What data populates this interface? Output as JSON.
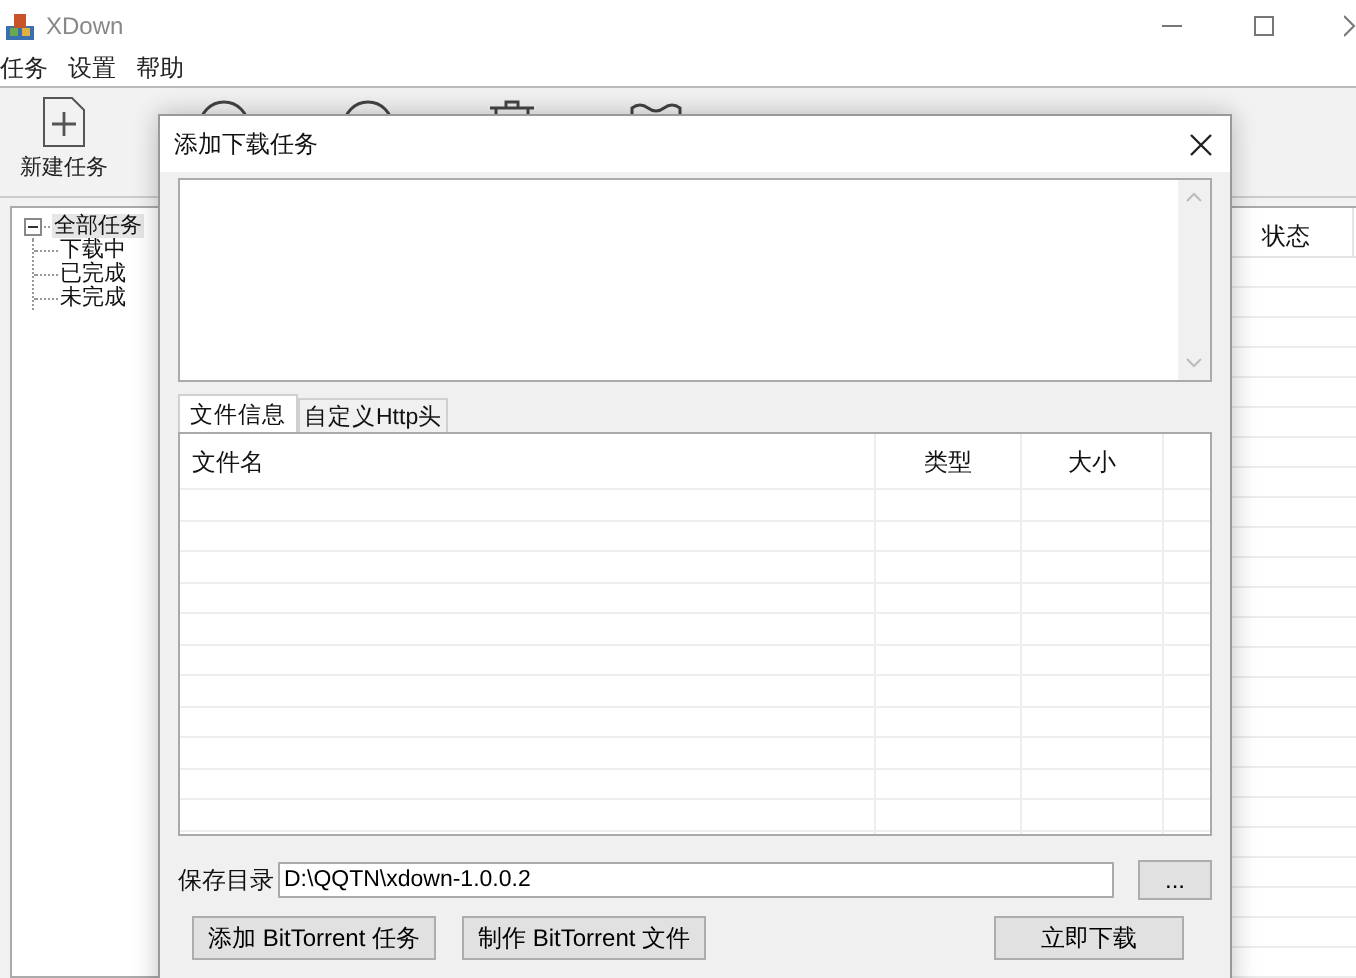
{
  "window": {
    "title": "XDown"
  },
  "menu": [
    "任务",
    "设置",
    "帮助"
  ],
  "toolbar": [
    {
      "label": "新建任务",
      "kind": "new"
    },
    {
      "kind": "circle"
    },
    {
      "kind": "circle"
    },
    {
      "kind": "trash"
    },
    {
      "kind": "folder"
    }
  ],
  "tree": [
    {
      "label": "全部任务",
      "expanded": true,
      "selected": true,
      "children": [
        {
          "label": "下载中",
          "selected": false
        },
        {
          "label": "已完成",
          "selected": false
        },
        {
          "label": "未完成",
          "selected": false
        }
      ]
    }
  ],
  "list": {
    "columns": [
      "状态"
    ]
  },
  "dialog": {
    "title": "添加下载任务",
    "tabs": [
      {
        "label": "文件信息",
        "selected": true
      },
      {
        "label": "自定义Http头",
        "selected": false
      }
    ],
    "table": {
      "columns": [
        "文件名",
        "类型",
        "大小"
      ]
    },
    "save_label": "保存目录",
    "save_path": "D:\\QQTN\\xdown-1.0.0.2",
    "browse": "...",
    "buttons": [
      {
        "label": "添加 BitTorrent 任务",
        "kind": "left"
      },
      {
        "label": "制作 BitTorrent 文件",
        "kind": "left"
      },
      {
        "label": "立即下载",
        "kind": "right"
      }
    ]
  }
}
